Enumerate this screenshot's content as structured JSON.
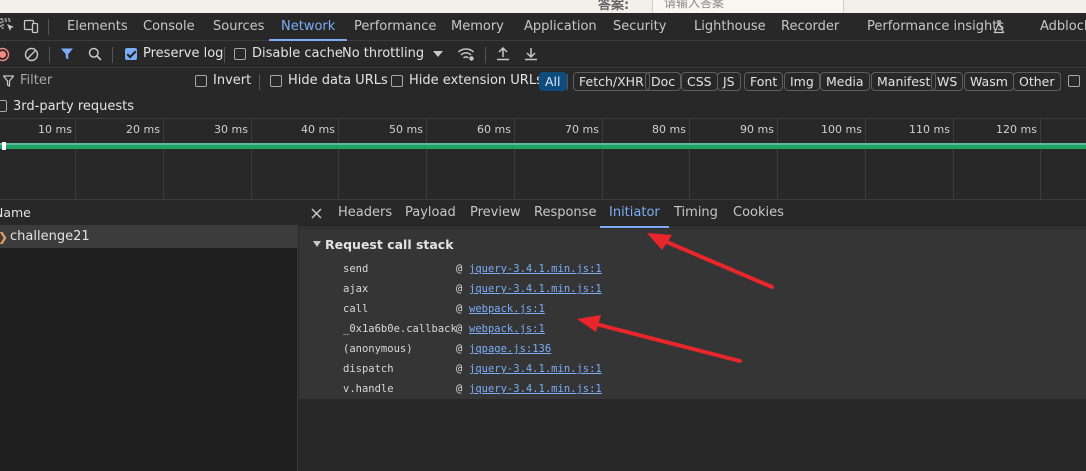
{
  "page_strip": {
    "label": "答案:",
    "placeholder": "请输入答案"
  },
  "tabs": [
    {
      "label": "Elements"
    },
    {
      "label": "Console"
    },
    {
      "label": "Sources"
    },
    {
      "label": "Network"
    },
    {
      "label": "Performance"
    },
    {
      "label": "Memory"
    },
    {
      "label": "Application"
    },
    {
      "label": "Security"
    },
    {
      "label": "Lighthouse"
    },
    {
      "label": "Recorder"
    },
    {
      "label": "Performance insights"
    },
    {
      "label": "Adblock"
    }
  ],
  "active_tab": "Network",
  "toolbar": {
    "preserve_log_label": "Preserve log",
    "preserve_log_checked": true,
    "disable_cache_label": "Disable cache",
    "disable_cache_checked": false,
    "throttling_value": "No throttling"
  },
  "filter": {
    "placeholder": "Filter",
    "invert_label": "Invert",
    "hide_data_urls_label": "Hide data URLs",
    "hide_extension_urls_label": "Hide extension URLs",
    "type_chips": [
      "All",
      "Fetch/XHR",
      "Doc",
      "CSS",
      "JS",
      "Font",
      "Img",
      "Media",
      "Manifest",
      "WS",
      "Wasm",
      "Other"
    ],
    "active_chip": "All",
    "third_party_label": "3rd-party requests"
  },
  "timeline": {
    "ticks": [
      "10 ms",
      "20 ms",
      "30 ms",
      "40 ms",
      "50 ms",
      "60 ms",
      "70 ms",
      "80 ms",
      "90 ms",
      "100 ms",
      "110 ms",
      "120 ms"
    ]
  },
  "request_list": {
    "header_name": "Name",
    "rows": [
      {
        "name": "challenge21"
      }
    ]
  },
  "detail_tabs": [
    "Headers",
    "Payload",
    "Preview",
    "Response",
    "Initiator",
    "Timing",
    "Cookies"
  ],
  "active_detail_tab": "Initiator",
  "initiator": {
    "section_title": "Request call stack",
    "stack": [
      {
        "fn": "send",
        "at": "@",
        "source": "jquery-3.4.1.min.js:1"
      },
      {
        "fn": "ajax",
        "at": "@",
        "source": "jquery-3.4.1.min.js:1"
      },
      {
        "fn": "call",
        "at": "@",
        "source": "webpack.js:1"
      },
      {
        "fn": "_0x1a6b0e.callback",
        "at": "@",
        "source": "webpack.js:1"
      },
      {
        "fn": "(anonymous)",
        "at": "@",
        "source": "jqpage.js:136"
      },
      {
        "fn": "dispatch",
        "at": "@",
        "source": "jquery-3.4.1.min.js:1"
      },
      {
        "fn": "v.handle",
        "at": "@",
        "source": "jquery-3.4.1.min.js:1"
      }
    ]
  },
  "colors": {
    "accent": "#7cacf8",
    "annotation_arrow": "#e8262b",
    "timeline_bar": "#1ea362"
  }
}
